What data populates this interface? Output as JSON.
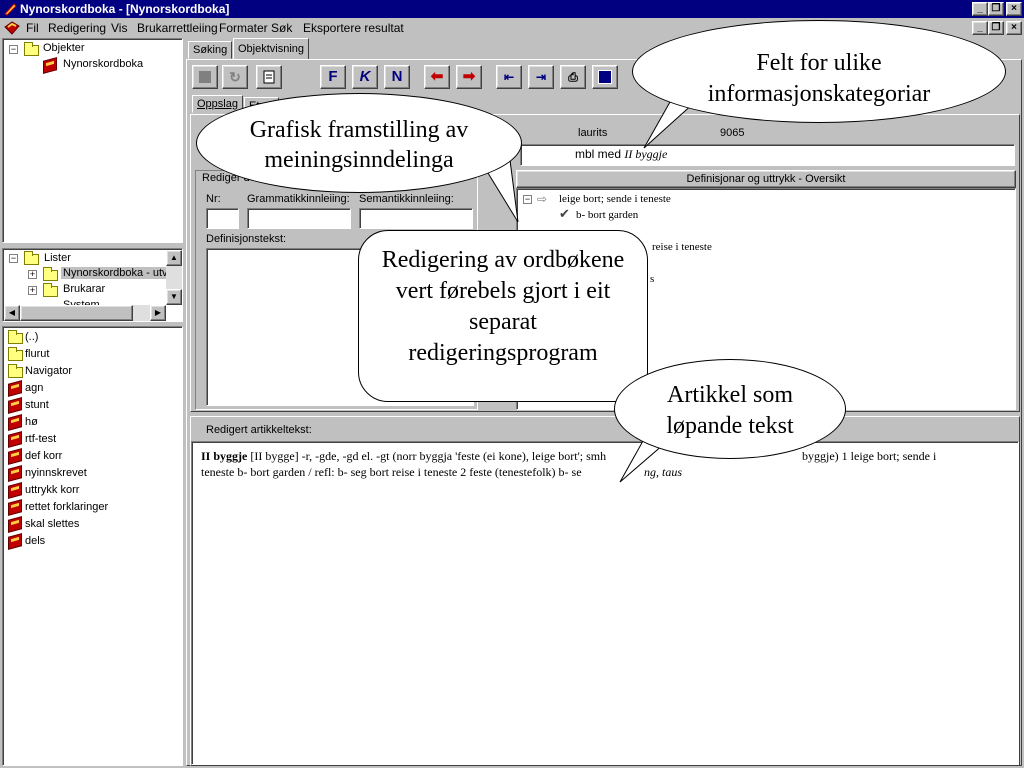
{
  "window": {
    "title": "Nynorskordboka - [Nynorskordboka]",
    "btn_min": "_",
    "btn_restore": "❐",
    "btn_close": "×"
  },
  "menu": {
    "items": [
      "Fil",
      "Redigering",
      "Vis",
      "Brukarrettleiing",
      "Formater",
      "Søk",
      "Eksportere resultat"
    ]
  },
  "tree_top": {
    "root": "Objekter",
    "child": "Nynorskordboka",
    "expander": "−"
  },
  "tree_lists": {
    "root": "Lister",
    "items": [
      "Nynorskordboka - utv",
      "Brukarar",
      "System"
    ],
    "collapse": "−",
    "expand": "+"
  },
  "file_list": {
    "items": [
      "(..)",
      "flurut",
      "Navigator",
      "agn",
      "stunt",
      "hø",
      "rtf-test",
      "def korr",
      "nyinnskrevet",
      "uttrykk korr",
      "rettet forklaringer",
      "skal slettes",
      "dels"
    ]
  },
  "tabs": {
    "main": [
      "Søking",
      "Objektvisning"
    ],
    "sub": [
      "Oppslag",
      "Etym"
    ]
  },
  "toolbar": {
    "f_label": "F",
    "k_label": "K",
    "n_label": "N"
  },
  "edit_panel": {
    "header": "Rediger d",
    "nr_label": "Nr:",
    "grammar_label": "Grammatikkinnleiing:",
    "semantic_label": "Semantikkinnleiing:",
    "definition_label": "Definisjonstekst:",
    "header_right_partial": "laurits",
    "header_right_number": "9065",
    "top_field_value": "mbl med ",
    "top_field_italic": "II byggje"
  },
  "overview": {
    "header": "Definisjonar og uttrykk - Oversikt",
    "items": [
      "leige bort; sende i teneste",
      "b- bort garden",
      "reise i teneste",
      "s"
    ]
  },
  "article": {
    "header": "Redigert artikkeltekst:",
    "line1_bold": "II byggje",
    "line1_rest": " [II bygge] -r, -gde, -gd el. -gt (norr byggja 'feste (ei kone), leige bort'; smh",
    "line1_right": "byggje) 1 leige bort; sende i",
    "line2": "teneste b- bort garden / refl: b- seg bort reise i teneste 2 feste (tenestefolk) b- se",
    "line2_end": "ng, taus"
  },
  "callouts": {
    "c1": "Grafisk framstilling av meiningsinndelinga",
    "c2": "Felt for ulike informasjonskategoriar",
    "c3": "Redigering av ordbøkene vert førebels gjort i eit separat redigeringsprogram",
    "c4": "Artikkel som løpande tekst"
  },
  "colors": {
    "title_bg": "#000080",
    "window_bg": "#c0c0c0",
    "selection": "#c0c0c0"
  }
}
